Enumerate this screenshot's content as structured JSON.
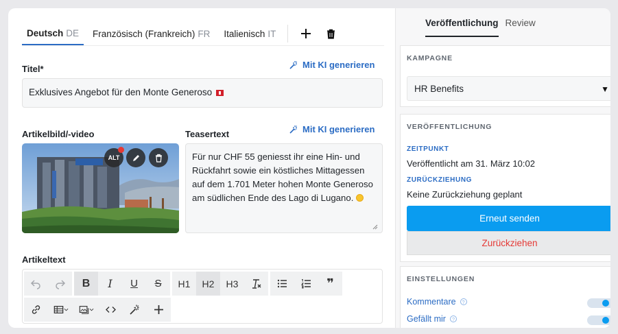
{
  "language_tabs": [
    {
      "label": "Deutsch",
      "code": "DE",
      "active": true
    },
    {
      "label": "Französisch (Frankreich)",
      "code": "FR",
      "active": false
    },
    {
      "label": "Italienisch",
      "code": "IT",
      "active": false
    }
  ],
  "title_field": {
    "label": "Titel*",
    "value": "Exklusives Angebot für den Monte Generoso",
    "ki_link": "Mit KI generieren"
  },
  "media": {
    "label": "Artikelbild/-video",
    "alt_badge": "ALT"
  },
  "teaser": {
    "label": "Teasertext",
    "ki_link": "Mit KI generieren",
    "value": "Für nur CHF 55 geniesst ihr eine Hin- und Rückfahrt sowie ein köstliches Mittagessen auf dem 1.701 Meter hohen Monte Generoso am südlichen Ende des Lago di Lugano."
  },
  "article": {
    "label": "Artikeltext",
    "toolbar_text": {
      "h1": "H1",
      "h2": "H2",
      "h3": "H3",
      "bold": "B",
      "italic": "I",
      "underline": "U",
      "strike": "S",
      "quote": "❞"
    }
  },
  "right_tabs": [
    {
      "label": "Veröffentlichung",
      "active": true
    },
    {
      "label": "Review",
      "active": false
    }
  ],
  "campaign": {
    "title": "KAMPAGNE",
    "selected": "HR Benefits"
  },
  "publication": {
    "title": "VERÖFFENTLICHUNG",
    "time_label": "ZEITPUNKT",
    "time_value": "Veröffentlicht am 31. März 10:02",
    "withdraw_label": "ZURÜCKZIEHUNG",
    "withdraw_value": "Keine Zurückziehung geplant",
    "resend_button": "Erneut senden",
    "withdraw_button": "Zurückziehen"
  },
  "settings": {
    "title": "EINSTELLUNGEN",
    "items": [
      {
        "label": "Kommentare",
        "enabled": true
      },
      {
        "label": "Gefällt mir",
        "enabled": true
      }
    ]
  },
  "colors": {
    "accent": "#2b6cc4",
    "primary_button": "#0a9cf0",
    "danger": "#e53935"
  }
}
